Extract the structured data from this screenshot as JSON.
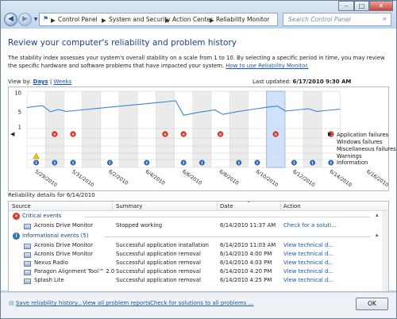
{
  "window": {
    "breadcrumbs": [
      "Control Panel",
      "System and Security",
      "Action Center",
      "Reliability Monitor"
    ],
    "search_placeholder": "Search Control Panel",
    "controls": {
      "minimize": "–",
      "maximize": "□",
      "close": "✕"
    }
  },
  "page": {
    "title": "Review your computer's reliability and problem history",
    "description": "The stability index assesses your system's overall stability on a scale from 1 to 10. By selecting a specific period in time, you may review the specific hardware and software problems that have impacted your system.",
    "description_link": "How to use Reliability Monitor.",
    "view_by_label": "View by:",
    "view_days": "Days",
    "view_separator": "|",
    "view_weeks": "Weeks",
    "last_updated_label": "Last updated:",
    "last_updated_value": "6/17/2010 9:30 AM"
  },
  "chart_data": {
    "type": "line",
    "ylim": [
      1,
      10
    ],
    "y_ticks": [
      "10",
      "5",
      "1"
    ],
    "x_tick_labels": [
      "5/29/2010",
      "5/31/2010",
      "6/2/2010",
      "6/4/2010",
      "6/6/2010",
      "6/8/2010",
      "6/10/2010",
      "6/12/2010",
      "6/14/2010",
      "6/16/2010"
    ],
    "selected_date": "6/14/2010",
    "stability_index": [
      6.1,
      6.4,
      6.6,
      5.0,
      5.6,
      5.1,
      5.3,
      5.5,
      5.7,
      5.9,
      6.1,
      6.3,
      6.5,
      6.7,
      6.9,
      7.1,
      7.3,
      7.5,
      7.7,
      7.9,
      4.1,
      4.5,
      4.9,
      5.2,
      5.5,
      4.3,
      4.7,
      5.1,
      5.4,
      5.7,
      6.0,
      6.3,
      6.5,
      5.2,
      5.4,
      5.6,
      5.8,
      5.1,
      5.3,
      5.5,
      5.7
    ],
    "rows": [
      "Application failures",
      "Windows failures",
      "Miscellaneous failures",
      "Warnings",
      "Information"
    ],
    "application_failure_columns": [
      1,
      2,
      7,
      8,
      10,
      13,
      16
    ],
    "warning_columns": [
      0
    ],
    "information_columns": [
      0,
      1,
      2,
      4,
      6,
      8,
      9,
      11,
      12,
      14,
      15,
      16
    ],
    "grid": true
  },
  "details": {
    "title": "Reliability details for 6/14/2010",
    "columns": [
      "Source",
      "Summary",
      "Date",
      "Action"
    ],
    "critical_label": "Critical events",
    "critical_rows": [
      {
        "source": "Acronis Drive Monitor",
        "summary": "Stopped working",
        "date": "6/14/2010 11:37 AM",
        "action": "Check for a soluti..."
      }
    ],
    "informational_label": "Informational events (5)",
    "informational_rows": [
      {
        "source": "Acronis Drive Monitor",
        "summary": "Successful application installation",
        "date": "6/14/2010 11:03 AM",
        "action": "View  technical d..."
      },
      {
        "source": "Acronis Drive Monitor",
        "summary": "Successful application removal",
        "date": "6/14/2010 4:00 PM",
        "action": "View  technical d..."
      },
      {
        "source": "Nexus Radio",
        "summary": "Successful application removal",
        "date": "6/14/2010 4:03 PM",
        "action": "View  technical d..."
      },
      {
        "source": "Paragon Alignment Tool™ 2.0",
        "summary": "Successful application removal",
        "date": "6/14/2010 4:20 PM",
        "action": "View  technical d..."
      },
      {
        "source": "Splash Lite",
        "summary": "Successful application removal",
        "date": "6/14/2010 4:25 PM",
        "action": "View  technical d..."
      }
    ]
  },
  "footer": {
    "save_history": "Save reliability history...",
    "view_all": "View all problem reports",
    "check_solutions": "Check for solutions to all problems ...",
    "ok": "OK"
  }
}
